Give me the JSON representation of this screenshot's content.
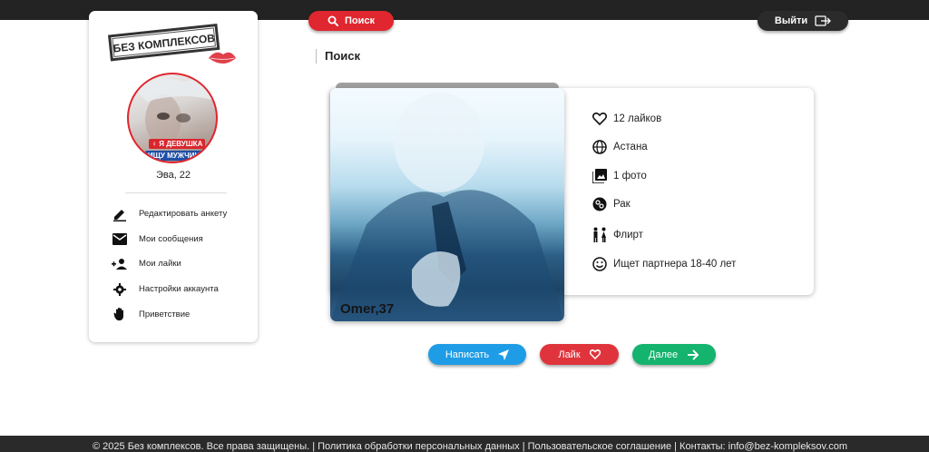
{
  "header": {
    "search_label": "Поиск",
    "logout_label": "Выйти"
  },
  "logo": {
    "text": "БЕЗ КОМПЛЕКСОВ"
  },
  "profile": {
    "name_age": "Эва, 22",
    "badge_gender": "Я ДЕВУШКА",
    "badge_looking": "ИЩУ МУЖЧИНУ"
  },
  "sidebar": {
    "items": [
      {
        "label": "Редактировать анкету",
        "icon": "pencil-icon"
      },
      {
        "label": "Мои сообщения",
        "icon": "envelope-icon"
      },
      {
        "label": "Мои лайки",
        "icon": "people-icon"
      },
      {
        "label": "Настройки аккаунта",
        "icon": "gear-icon"
      },
      {
        "label": "Приветствие",
        "icon": "hand-icon"
      }
    ]
  },
  "main": {
    "title": "Поиск"
  },
  "card": {
    "name_age": "Omer,37",
    "info": [
      {
        "text": "12 лайков",
        "icon": "heart-icon"
      },
      {
        "text": "Астана",
        "icon": "globe-icon"
      },
      {
        "text": "1 фото",
        "icon": "photos-icon"
      },
      {
        "text": "Рак",
        "icon": "zodiac-icon"
      },
      {
        "text": "Флирт",
        "icon": "couple-icon"
      },
      {
        "text": "Ищет партнера 18-40 лет",
        "icon": "smile-icon"
      }
    ]
  },
  "actions": {
    "write_label": "Написать",
    "like_label": "Лайк",
    "next_label": "Далее"
  },
  "footer": {
    "text": "© 2025 Без комплексов. Все права защищены.  | Политика обработки персональных данных | Пользовательское соглашение | Контакты: info@bez-kompleksov.com"
  },
  "colors": {
    "accent_red": "#e0262f",
    "write_blue": "#1f9ce6",
    "like_red": "#e0343d",
    "next_green": "#14b36e",
    "dark_bar": "#232323"
  }
}
